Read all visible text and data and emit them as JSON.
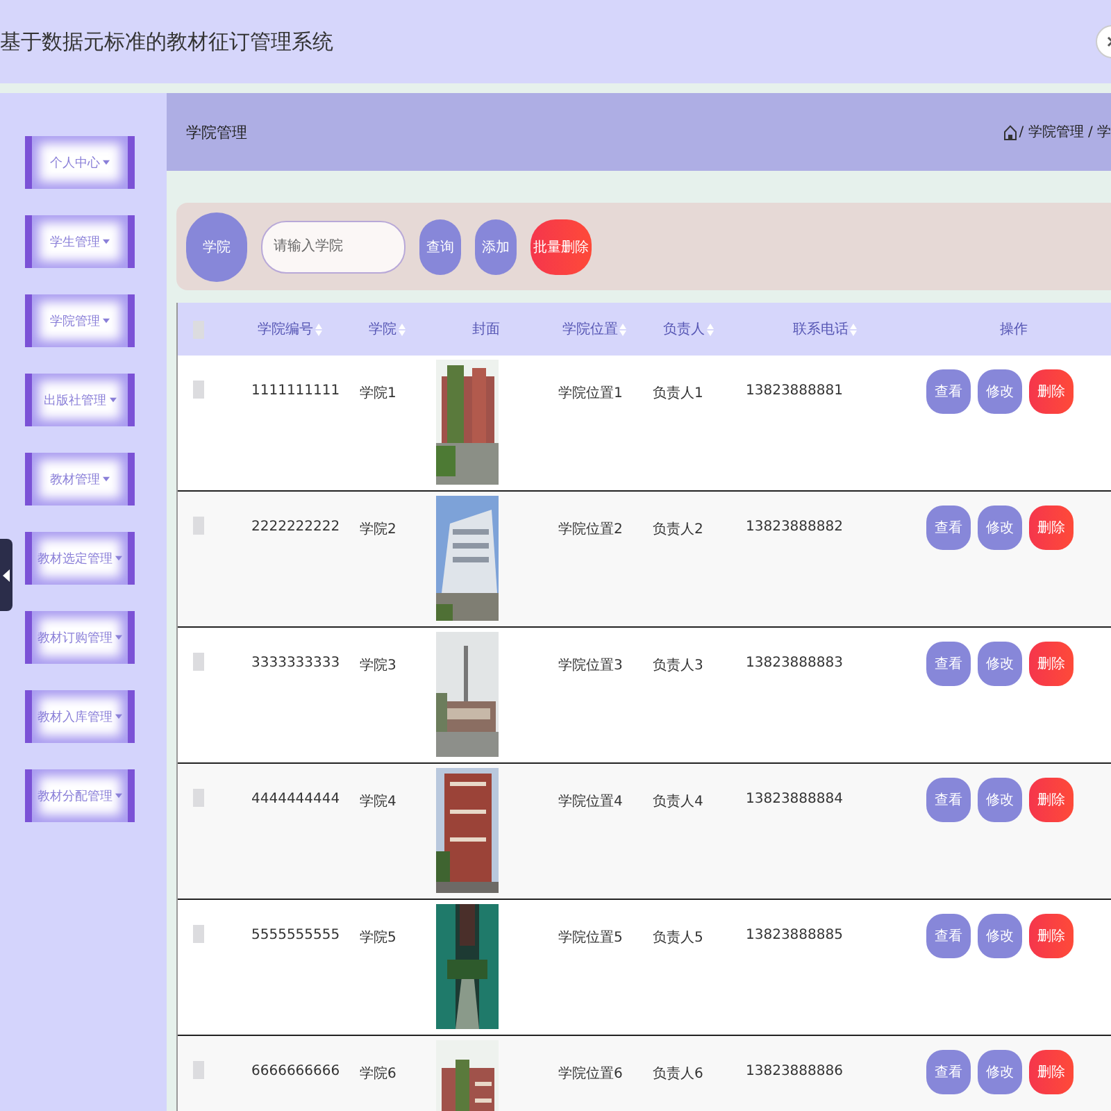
{
  "header": {
    "title": "基于数据元标准的教材征订管理系统"
  },
  "sidebar": {
    "items": [
      {
        "label": "个人中心"
      },
      {
        "label": "学生管理"
      },
      {
        "label": "学院管理"
      },
      {
        "label": "出版社管理"
      },
      {
        "label": "教材管理"
      },
      {
        "label": "教材选定管理"
      },
      {
        "label": "教材订购管理"
      },
      {
        "label": "教材入库管理"
      },
      {
        "label": "教材分配管理"
      }
    ]
  },
  "breadcrumb": {
    "title": "学院管理",
    "path": "/ 学院管理 / 学"
  },
  "search": {
    "label": "学院",
    "placeholder": "请输入学院",
    "buttons": [
      {
        "label": "查询",
        "kind": "primary"
      },
      {
        "label": "添加",
        "kind": "primary"
      },
      {
        "label": "批量删除",
        "kind": "danger"
      }
    ]
  },
  "table": {
    "select_all": {
      "checked": false
    },
    "columns": [
      {
        "label": "学院编号",
        "sortable": true
      },
      {
        "label": "学院",
        "sortable": true
      },
      {
        "label": "封面",
        "sortable": false
      },
      {
        "label": "学院位置",
        "sortable": true
      },
      {
        "label": "负责人",
        "sortable": true
      },
      {
        "label": "联系电话",
        "sortable": true
      },
      {
        "label": "操作",
        "sortable": false
      }
    ],
    "rows": [
      {
        "checked": false,
        "id": "1111111111",
        "name": "学院1",
        "location": "学院位置1",
        "manager": "负责人1",
        "phone": "13823888881",
        "actions": [
          {
            "label": "查看",
            "kind": "primary"
          },
          {
            "label": "修改",
            "kind": "primary"
          },
          {
            "label": "删除",
            "kind": "danger"
          }
        ]
      },
      {
        "checked": false,
        "id": "2222222222",
        "name": "学院2",
        "location": "学院位置2",
        "manager": "负责人2",
        "phone": "13823888882",
        "actions": [
          {
            "label": "查看",
            "kind": "primary"
          },
          {
            "label": "修改",
            "kind": "primary"
          },
          {
            "label": "删除",
            "kind": "danger"
          }
        ]
      },
      {
        "checked": false,
        "id": "3333333333",
        "name": "学院3",
        "location": "学院位置3",
        "manager": "负责人3",
        "phone": "13823888883",
        "actions": [
          {
            "label": "查看",
            "kind": "primary"
          },
          {
            "label": "修改",
            "kind": "primary"
          },
          {
            "label": "删除",
            "kind": "danger"
          }
        ]
      },
      {
        "checked": false,
        "id": "4444444444",
        "name": "学院4",
        "location": "学院位置4",
        "manager": "负责人4",
        "phone": "13823888884",
        "actions": [
          {
            "label": "查看",
            "kind": "primary"
          },
          {
            "label": "修改",
            "kind": "primary"
          },
          {
            "label": "删除",
            "kind": "danger"
          }
        ]
      },
      {
        "checked": false,
        "id": "5555555555",
        "name": "学院5",
        "location": "学院位置5",
        "manager": "负责人5",
        "phone": "13823888885",
        "actions": [
          {
            "label": "查看",
            "kind": "primary"
          },
          {
            "label": "修改",
            "kind": "primary"
          },
          {
            "label": "删除",
            "kind": "danger"
          }
        ]
      },
      {
        "checked": false,
        "id": "6666666666",
        "name": "学院6",
        "location": "学院位置6",
        "manager": "负责人6",
        "phone": "13823888886",
        "actions": [
          {
            "label": "查看",
            "kind": "primary"
          },
          {
            "label": "修改",
            "kind": "primary"
          },
          {
            "label": "删除",
            "kind": "danger"
          }
        ]
      }
    ]
  }
}
